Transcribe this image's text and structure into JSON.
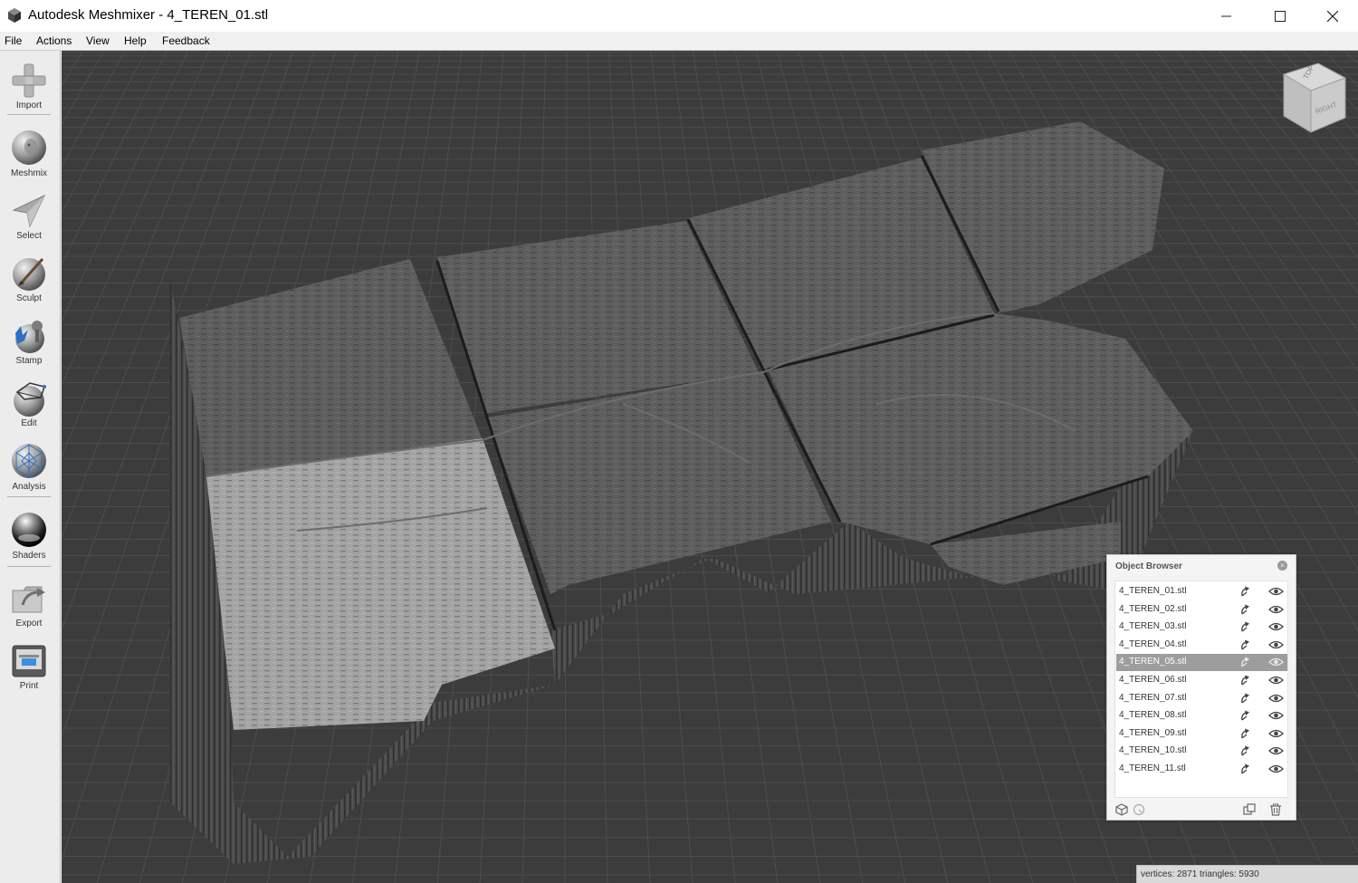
{
  "window": {
    "title": "Autodesk Meshmixer - 4_TEREN_01.stl",
    "controls": {
      "minimize": "minimize-icon",
      "maximize": "maximize-icon",
      "close": "close-icon"
    }
  },
  "menu": {
    "items": [
      "File",
      "Actions",
      "View",
      "Help",
      "Feedback"
    ]
  },
  "toolbar": {
    "tools": [
      {
        "label": "Import",
        "icon": "plus-icon"
      },
      {
        "label": "Meshmix",
        "icon": "head-sphere-icon"
      },
      {
        "label": "Select",
        "icon": "arrow-cursor-icon"
      },
      {
        "label": "Sculpt",
        "icon": "brush-icon"
      },
      {
        "label": "Stamp",
        "icon": "stamp-icon"
      },
      {
        "label": "Edit",
        "icon": "edit-sphere-icon"
      },
      {
        "label": "Analysis",
        "icon": "mesh-sphere-icon"
      },
      {
        "label": "Shaders",
        "icon": "shader-sphere-icon"
      },
      {
        "label": "Export",
        "icon": "export-icon"
      },
      {
        "label": "Print",
        "icon": "printer-icon"
      }
    ]
  },
  "viewcube": {
    "top_label": "TOP",
    "right_label": "RIGHT"
  },
  "object_browser": {
    "title": "Object Browser",
    "objects": [
      {
        "name": "4_TEREN_01.stl",
        "selected": false
      },
      {
        "name": "4_TEREN_02.stl",
        "selected": false
      },
      {
        "name": "4_TEREN_03.stl",
        "selected": false
      },
      {
        "name": "4_TEREN_04.stl",
        "selected": false
      },
      {
        "name": "4_TEREN_05.stl",
        "selected": true
      },
      {
        "name": "4_TEREN_06.stl",
        "selected": false
      },
      {
        "name": "4_TEREN_07.stl",
        "selected": false
      },
      {
        "name": "4_TEREN_08.stl",
        "selected": false
      },
      {
        "name": "4_TEREN_09.stl",
        "selected": false
      },
      {
        "name": "4_TEREN_10.stl",
        "selected": false
      },
      {
        "name": "4_TEREN_11.stl",
        "selected": false
      }
    ]
  },
  "status": {
    "text": "vertices: 2871 triangles: 5930"
  },
  "colors": {
    "viewport_bg": "#3c3c3c",
    "grid_line": "#4d4d4d",
    "mesh_top": "#5e5e5e",
    "mesh_highlight": "#a3a3a3",
    "mesh_side": "#4a4a4a",
    "selection_row": "#9d9d9d"
  }
}
